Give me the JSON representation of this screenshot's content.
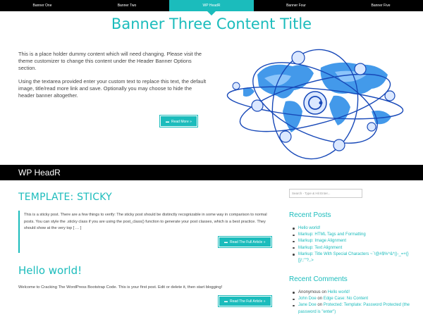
{
  "tabs": [
    {
      "label": "Banner One",
      "active": false
    },
    {
      "label": "Banner Two",
      "active": false
    },
    {
      "label": "WP HeadR",
      "active": true
    },
    {
      "label": "Banner Four",
      "active": false
    },
    {
      "label": "Banner Five",
      "active": false
    }
  ],
  "banner": {
    "title": "Banner Three Content Title",
    "paragraph1": "This is a place holder dummy content which will need changing. Please visit the theme customizer to change this content under the Header Banner Options section.",
    "paragraph2": "Using the textarea provided enter your custom text to replace this text, the default image, title/read more link and save. Optionally you may choose to hide the header banner altogether.",
    "read_more": "Read More »"
  },
  "header": {
    "site_title": "WP HeadR"
  },
  "posts": [
    {
      "title": "TEMPLATE: STICKY",
      "excerpt": "This is a sticky post. There are a few things to verify: The sticky post should be distinctly recognizable in some way in comparison to normal posts. You can style the .sticky class if you are using the post_class() function to generate your post classes, which is a best practice. They should show at the very top [ … ]",
      "button": "Read The Full Article »"
    },
    {
      "title": "Hello world!",
      "excerpt": "Welcome to Cracking The WordPress Bootstrap Code. This is your first post. Edit or delete it, then start blogging!",
      "button": "Read The Full Article »"
    }
  ],
  "sidebar": {
    "search_placeholder": "Search - Type & Hit Enter...",
    "recent_posts_heading": "Recent Posts",
    "recent_posts": [
      "Hello world!",
      "Markup: HTML Tags and Formatting",
      "Markup: Image Alignment",
      "Markup: Text Alignment",
      "Markup: Title With Special Characters ~`!@#$%^&*()-_=+{}[]/;:'\"?,.>"
    ],
    "recent_comments_heading": "Recent Comments",
    "recent_comments": [
      {
        "author": "Anonymous",
        "on": "on",
        "post": "Hello world!"
      },
      {
        "author": "John Doe",
        "on": "on",
        "post": "Edge Case: No Content"
      },
      {
        "author": "Jane Doe",
        "on": "on",
        "post": "Protected: Template: Password Protected (the password is \"enter\")"
      }
    ]
  },
  "colors": {
    "accent": "#1bbcbc",
    "bar": "#000000"
  },
  "icons": {
    "button_icon": "folder-icon"
  }
}
